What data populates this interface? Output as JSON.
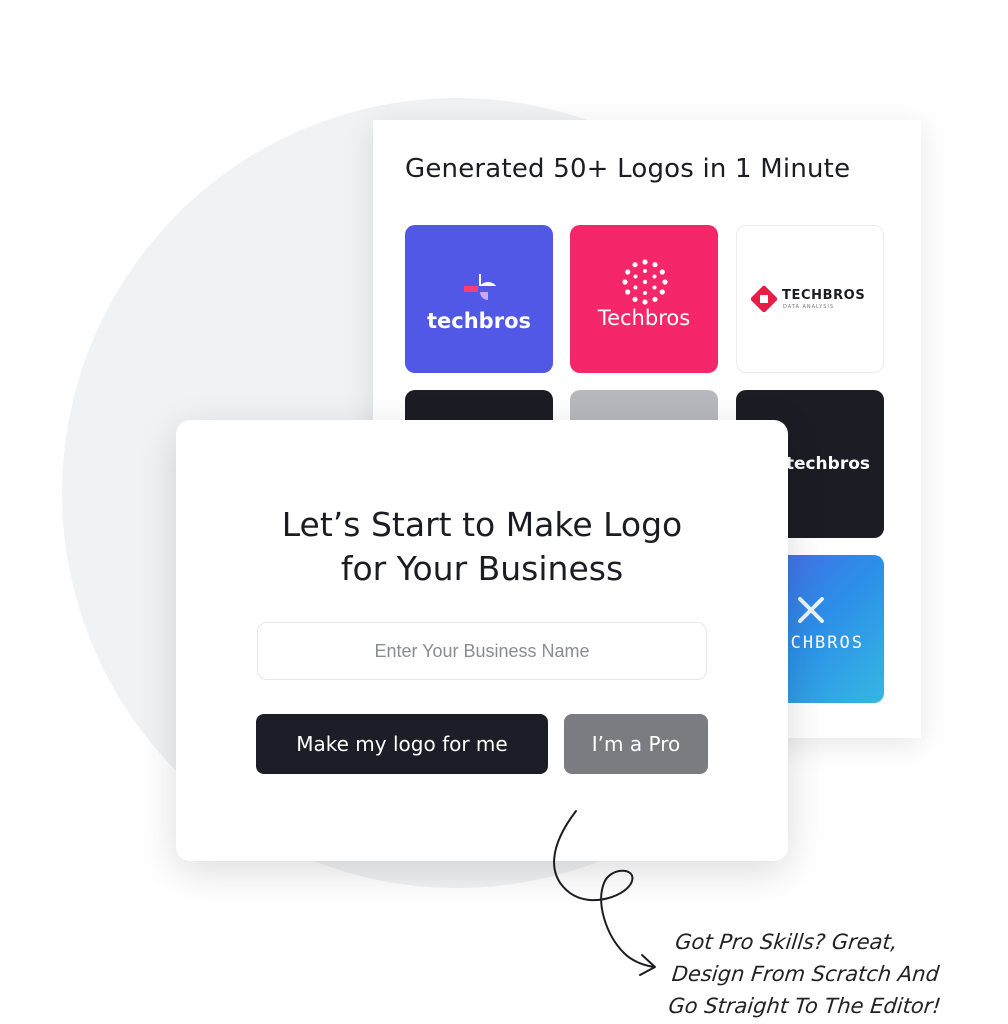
{
  "gallery": {
    "title": "Generated 50+ Logos in 1 Minute",
    "tiles": [
      {
        "brand": "techbros",
        "color": "#5058e5"
      },
      {
        "brand": "Techbros",
        "color": "#f5266a"
      },
      {
        "brand": "TECHBROS",
        "tagline": "DATA ANALYSIS",
        "color": "#ffffff"
      },
      {
        "color": "#1c1d24"
      },
      {
        "color": "#b7b8bd"
      },
      {
        "brand": "techbros",
        "color": "#1c1d24"
      },
      {
        "brand": "CHBROS",
        "color": "#2c8ee8"
      }
    ]
  },
  "start_card": {
    "headline_line1": "Let’s Start to Make Logo",
    "headline_line2": "for Your Business",
    "input_placeholder": "Enter Your Business Name",
    "primary_button": "Make my logo for me",
    "secondary_button": "I’m a Pro"
  },
  "note": {
    "line1": "Got Pro Skills? Great,",
    "line2": "Design From Scratch And",
    "line3": "Go Straight To The Editor!"
  }
}
